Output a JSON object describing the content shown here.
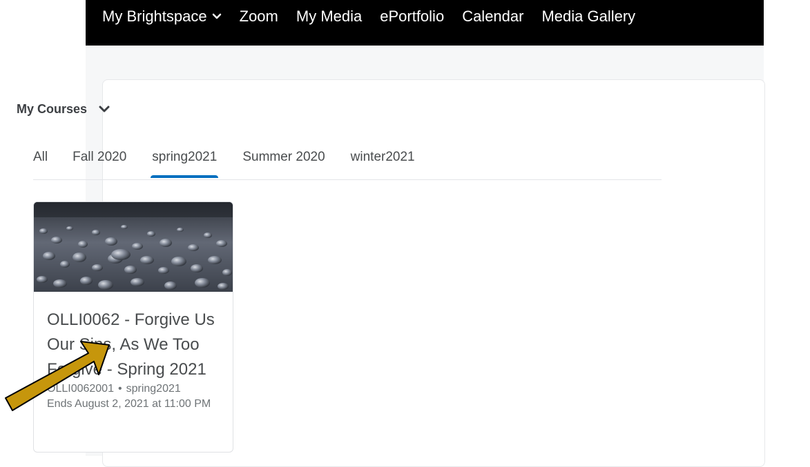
{
  "navbar": {
    "items": [
      {
        "label": "My Brightspace",
        "has_dropdown": true
      },
      {
        "label": "Zoom"
      },
      {
        "label": "My Media"
      },
      {
        "label": "ePortfolio"
      },
      {
        "label": "Calendar"
      },
      {
        "label": "Media Gallery"
      }
    ]
  },
  "widget": {
    "title": "My Courses",
    "tabs": [
      {
        "label": "All",
        "active": false
      },
      {
        "label": "Fall 2020",
        "active": false
      },
      {
        "label": "spring2021",
        "active": true
      },
      {
        "label": "Summer 2020",
        "active": false
      },
      {
        "label": "winter2021",
        "active": false
      }
    ]
  },
  "course_card": {
    "title": "OLLI0062 - Forgive Us Our Sins, As We Too Forgive - Spring 2021",
    "code": "OLLI0062001",
    "separator": "•",
    "semester": "spring2021",
    "end_date": "Ends August 2, 2021 at 11:00 PM",
    "image_alt": "water droplets image"
  },
  "colors": {
    "navbar_bg": "#000000",
    "active_tab_indicator": "#006fbf",
    "arrow": "#c6960c"
  }
}
